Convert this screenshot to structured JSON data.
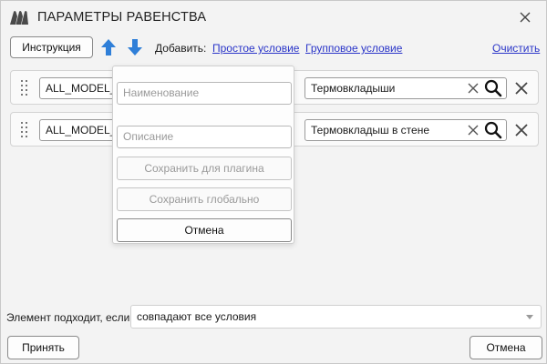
{
  "window": {
    "title": "ПАРАМЕТРЫ РАВЕНСТВА"
  },
  "toolbar": {
    "instruction_label": "Инструкция",
    "add_label": "Добавить:",
    "simple_condition_link": "Простое условие",
    "group_condition_link": "Групповое условие",
    "clear_link": "Очистить"
  },
  "conditions": [
    {
      "field": "ALL_MODEL_M",
      "value": "Термовкладыши"
    },
    {
      "field": "ALL_MODEL_D",
      "value": "Термовкладыш в стене"
    }
  ],
  "save_popup": {
    "name_placeholder": "Наименование",
    "description_placeholder": "Описание",
    "save_plugin_label": "Сохранить для плагина",
    "save_global_label": "Сохранить глобально",
    "cancel_label": "Отмена"
  },
  "footer": {
    "match_label": "Элемент подходит, если",
    "match_value": "совпадают все условия",
    "accept_label": "Принять",
    "cancel_label": "Отмена"
  },
  "colors": {
    "accent_arrow": "#2f7fd8",
    "link": "#2a35c8",
    "logo": "#4a4a4a"
  },
  "icons": [
    "app-logo-icon",
    "close-icon",
    "arrow-up-icon",
    "arrow-down-icon",
    "drag-handle-icon",
    "clear-icon",
    "search-icon",
    "remove-icon",
    "chevron-down-icon"
  ]
}
